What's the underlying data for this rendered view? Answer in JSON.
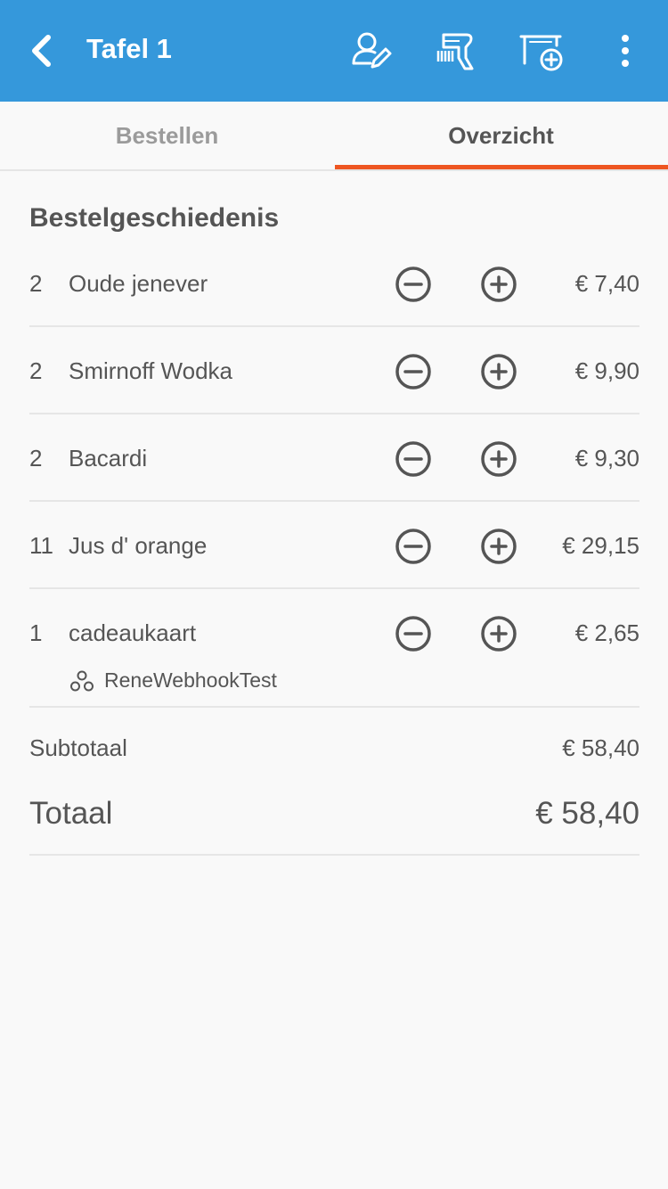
{
  "header": {
    "title": "Tafel 1",
    "back_icon": "chevron-left-icon",
    "actions": [
      {
        "icon": "edit-customer-icon"
      },
      {
        "icon": "barcode-scanner-icon"
      },
      {
        "icon": "add-table-icon"
      },
      {
        "icon": "more-vertical-icon"
      }
    ]
  },
  "tabs": [
    {
      "label": "Bestellen",
      "active": false
    },
    {
      "label": "Overzicht",
      "active": true
    }
  ],
  "section": {
    "title": "Bestelgeschiedenis"
  },
  "orders": [
    {
      "qty": "2",
      "name": "Oude jenever",
      "price": "€ 7,40"
    },
    {
      "qty": "2",
      "name": "Smirnoff Wodka",
      "price": "€ 9,90"
    },
    {
      "qty": "2",
      "name": "Bacardi",
      "price": "€ 9,30"
    },
    {
      "qty": "11",
      "name": "Jus d' orange",
      "price": "€ 29,15"
    },
    {
      "qty": "1",
      "name": "cadeaukaart",
      "price": "€ 2,65",
      "sub": "ReneWebhookTest"
    }
  ],
  "summary": {
    "subtotal_label": "Subtotaal",
    "subtotal_value": "€ 58,40",
    "total_label": "Totaal",
    "total_value": "€ 58,40"
  },
  "colors": {
    "header": "#3598db",
    "accent": "#ee5622",
    "background": "#f9f9f9",
    "text": "#555555"
  }
}
